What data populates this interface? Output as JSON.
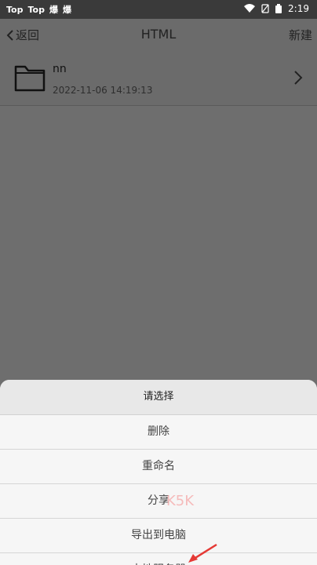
{
  "statusbar": {
    "left_labels": [
      "Top",
      "Top",
      "爆",
      "爆"
    ],
    "time": "2:19"
  },
  "appbar": {
    "back_label": "返回",
    "title": "HTML",
    "new_label": "新建"
  },
  "files": [
    {
      "name": "nn",
      "date": "2022-11-06 14:19:13"
    }
  ],
  "sheet": {
    "title": "请选择",
    "items": [
      "删除",
      "重命名",
      "分享",
      "导出到电脑",
      "本地服务器"
    ]
  },
  "watermark": "K5K",
  "colors": {
    "dim_overlay": "#6e6e6e",
    "sheet_bg": "#f1f1f1",
    "arrow": "#e53935"
  }
}
